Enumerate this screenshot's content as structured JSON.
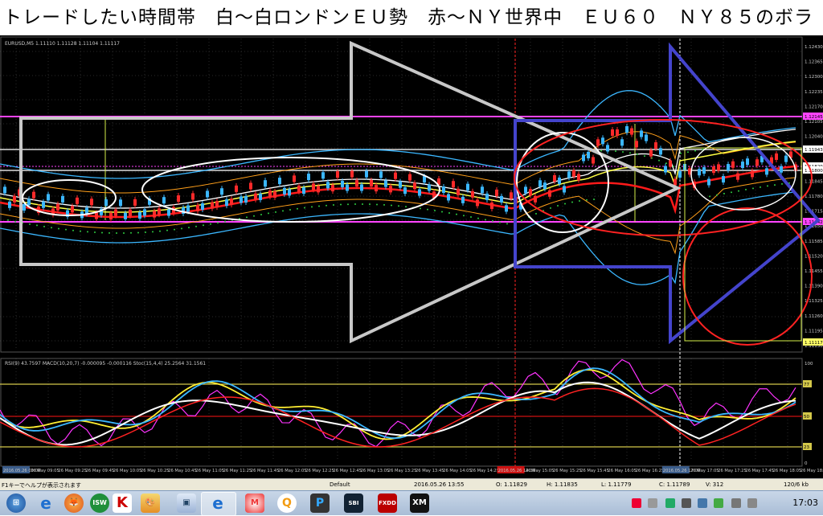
{
  "headline": "トレードしたい時間帯　白〜白ロンドンＥＵ勢　赤〜ＮＹ世界中　ＥＵ６０　ＮＹ８５のボラ",
  "main_chart": {
    "info": "EURUSD,M5  1.11110 1.11128 1.11104 1.11117",
    "price_labels": [
      "1.12430",
      "1.12365",
      "1.12300",
      "1.12235",
      "1.12170",
      "1.12105",
      "1.12040",
      "1.11975",
      "1.11910",
      "1.11845",
      "1.11780",
      "1.11715",
      "1.11650",
      "1.11585",
      "1.11520",
      "1.11455",
      "1.11390",
      "1.11325",
      "1.11260",
      "1.11195",
      "1.11130"
    ],
    "price_tags": [
      "1.12145",
      "1.11943",
      "1.11829",
      "1.11800",
      "1.11642",
      "1.11117"
    ]
  },
  "sub_chart": {
    "info": "RSI(9) 43.7597  MACD(10,20,7) -0.000095 -0.000116  Stoc(15,4,4) 25.2564 31.1561",
    "scale": [
      "100",
      "0"
    ],
    "levels": [
      "77",
      "50",
      "23"
    ]
  },
  "time_axis": [
    "2016.05.26 09:00",
    "26 May 09:05",
    "26 May 09:25",
    "26 May 09:45",
    "26 May 10:05",
    "26 May 10:25",
    "26 May 10:45",
    "26 May 11:05",
    "26 May 11:25",
    "26 May 11:45",
    "26 May 12:05",
    "26 May 12:25",
    "26 May 12:45",
    "26 May 13:05",
    "26 May 13:25",
    "26 May 13:45",
    "26 May 14:05",
    "26 May 14:25",
    "2016.05.26 14:30",
    "26 May 15:05",
    "26 May 15:25",
    "26 May 15:45",
    "26 May 16:05",
    "26 May 16:25",
    "2016.05.26 17:00",
    "26 May 17:05",
    "26 May 17:25",
    "26 May 17:45",
    "26 May 18:05",
    "26 May 18:25"
  ],
  "status": {
    "help": "F1キーでヘルプが表示されます",
    "profile": "Default",
    "datetime": "2016.05.26 13:55",
    "open": "O: 1.11829",
    "high": "H: 1.11835",
    "low": "L: 1.11779",
    "close": "C: 1.11789",
    "volume": "V: 312",
    "traffic": "120/6 kb"
  },
  "taskbar": {
    "clock": "17:03",
    "apps": [
      "start-orb",
      "ie",
      "firefox",
      "isw",
      "kaspersky",
      "paint",
      "messenger",
      "ie2",
      "mario",
      "quicktime",
      "pvr",
      "sbi-fx",
      "fxdd",
      "xm"
    ]
  }
}
